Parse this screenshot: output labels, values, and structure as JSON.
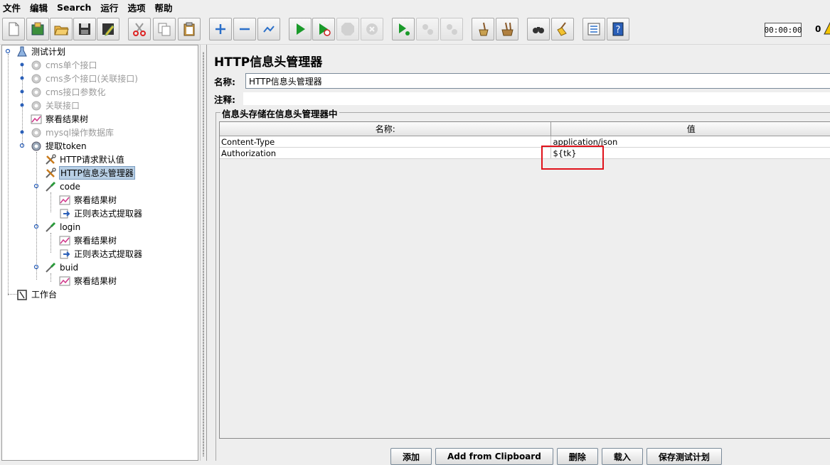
{
  "menu": {
    "items": [
      "文件",
      "编辑",
      "Search",
      "运行",
      "选项",
      "帮助"
    ]
  },
  "toolbar": {
    "buttons": [
      {
        "name": "new-icon",
        "enabled": true
      },
      {
        "name": "templates-icon",
        "enabled": true
      },
      {
        "name": "open-icon",
        "enabled": true
      },
      {
        "name": "save-icon",
        "enabled": true
      },
      {
        "name": "save-as-icon",
        "enabled": true
      },
      {
        "name": "cut-icon",
        "enabled": true
      },
      {
        "name": "copy-icon",
        "enabled": true
      },
      {
        "name": "paste-icon",
        "enabled": true
      },
      {
        "name": "expand-icon",
        "enabled": true
      },
      {
        "name": "collapse-icon",
        "enabled": true
      },
      {
        "name": "toggle-icon",
        "enabled": true
      },
      {
        "name": "start-icon",
        "enabled": true
      },
      {
        "name": "start-no-timers-icon",
        "enabled": true
      },
      {
        "name": "stop-icon",
        "enabled": false
      },
      {
        "name": "shutdown-icon",
        "enabled": false
      },
      {
        "name": "remote-start-icon",
        "enabled": true
      },
      {
        "name": "remote-stop-icon",
        "enabled": false
      },
      {
        "name": "remote-shutdown-icon",
        "enabled": false
      },
      {
        "name": "clear-icon",
        "enabled": true
      },
      {
        "name": "clear-all-icon",
        "enabled": true
      },
      {
        "name": "search-icon",
        "enabled": true
      },
      {
        "name": "reset-search-icon",
        "enabled": true
      },
      {
        "name": "function-helper-icon",
        "enabled": true
      },
      {
        "name": "help-icon",
        "enabled": true
      }
    ],
    "timer": "00:00:00",
    "error_count": "0"
  },
  "tree": {
    "items": [
      {
        "label": "测试计划",
        "icon": "test-plan-icon",
        "disabled": false
      },
      {
        "label": "cms单个接口",
        "icon": "thread-group-icon",
        "disabled": true
      },
      {
        "label": "cms多个接口(关联接口)",
        "icon": "thread-group-icon",
        "disabled": true
      },
      {
        "label": "cms接口参数化",
        "icon": "thread-group-icon",
        "disabled": true
      },
      {
        "label": "关联接口",
        "icon": "thread-group-icon",
        "disabled": true
      },
      {
        "label": "察看结果树",
        "icon": "results-tree-icon",
        "disabled": false
      },
      {
        "label": "mysql操作数据库",
        "icon": "thread-group-icon",
        "disabled": true
      },
      {
        "label": "提取token",
        "icon": "thread-group-icon",
        "disabled": false
      },
      {
        "label": "HTTP请求默认值",
        "icon": "config-icon",
        "disabled": false
      },
      {
        "label": "HTTP信息头管理器",
        "icon": "config-icon",
        "disabled": false,
        "selected": true
      },
      {
        "label": "code",
        "icon": "sampler-icon",
        "disabled": false
      },
      {
        "label": "察看结果树",
        "icon": "results-tree-icon",
        "disabled": false
      },
      {
        "label": "正则表达式提取器",
        "icon": "extractor-icon",
        "disabled": false
      },
      {
        "label": "login",
        "icon": "sampler-icon",
        "disabled": false
      },
      {
        "label": "察看结果树",
        "icon": "results-tree-icon",
        "disabled": false
      },
      {
        "label": "正则表达式提取器",
        "icon": "extractor-icon",
        "disabled": false
      },
      {
        "label": "buid",
        "icon": "sampler-icon",
        "disabled": false
      },
      {
        "label": "察看结果树",
        "icon": "results-tree-icon",
        "disabled": false
      },
      {
        "label": "工作台",
        "icon": "workbench-icon",
        "disabled": false
      }
    ]
  },
  "panel": {
    "title": "HTTP信息头管理器",
    "name_label": "名称:",
    "name_value": "HTTP信息头管理器",
    "comment_label": "注释:",
    "comment_value": "",
    "group_title": "信息头存储在信息头管理器中",
    "table": {
      "headers": [
        "名称:",
        "值"
      ],
      "rows": [
        [
          "Content-Type",
          "application/json"
        ],
        [
          "Authorization",
          "${tk}"
        ]
      ]
    },
    "buttons": [
      "添加",
      "Add from Clipboard",
      "删除",
      "载入",
      "保存测试计划"
    ]
  },
  "colors": {
    "highlight_box": "#e0121b",
    "selection": "#b8cfe5"
  }
}
